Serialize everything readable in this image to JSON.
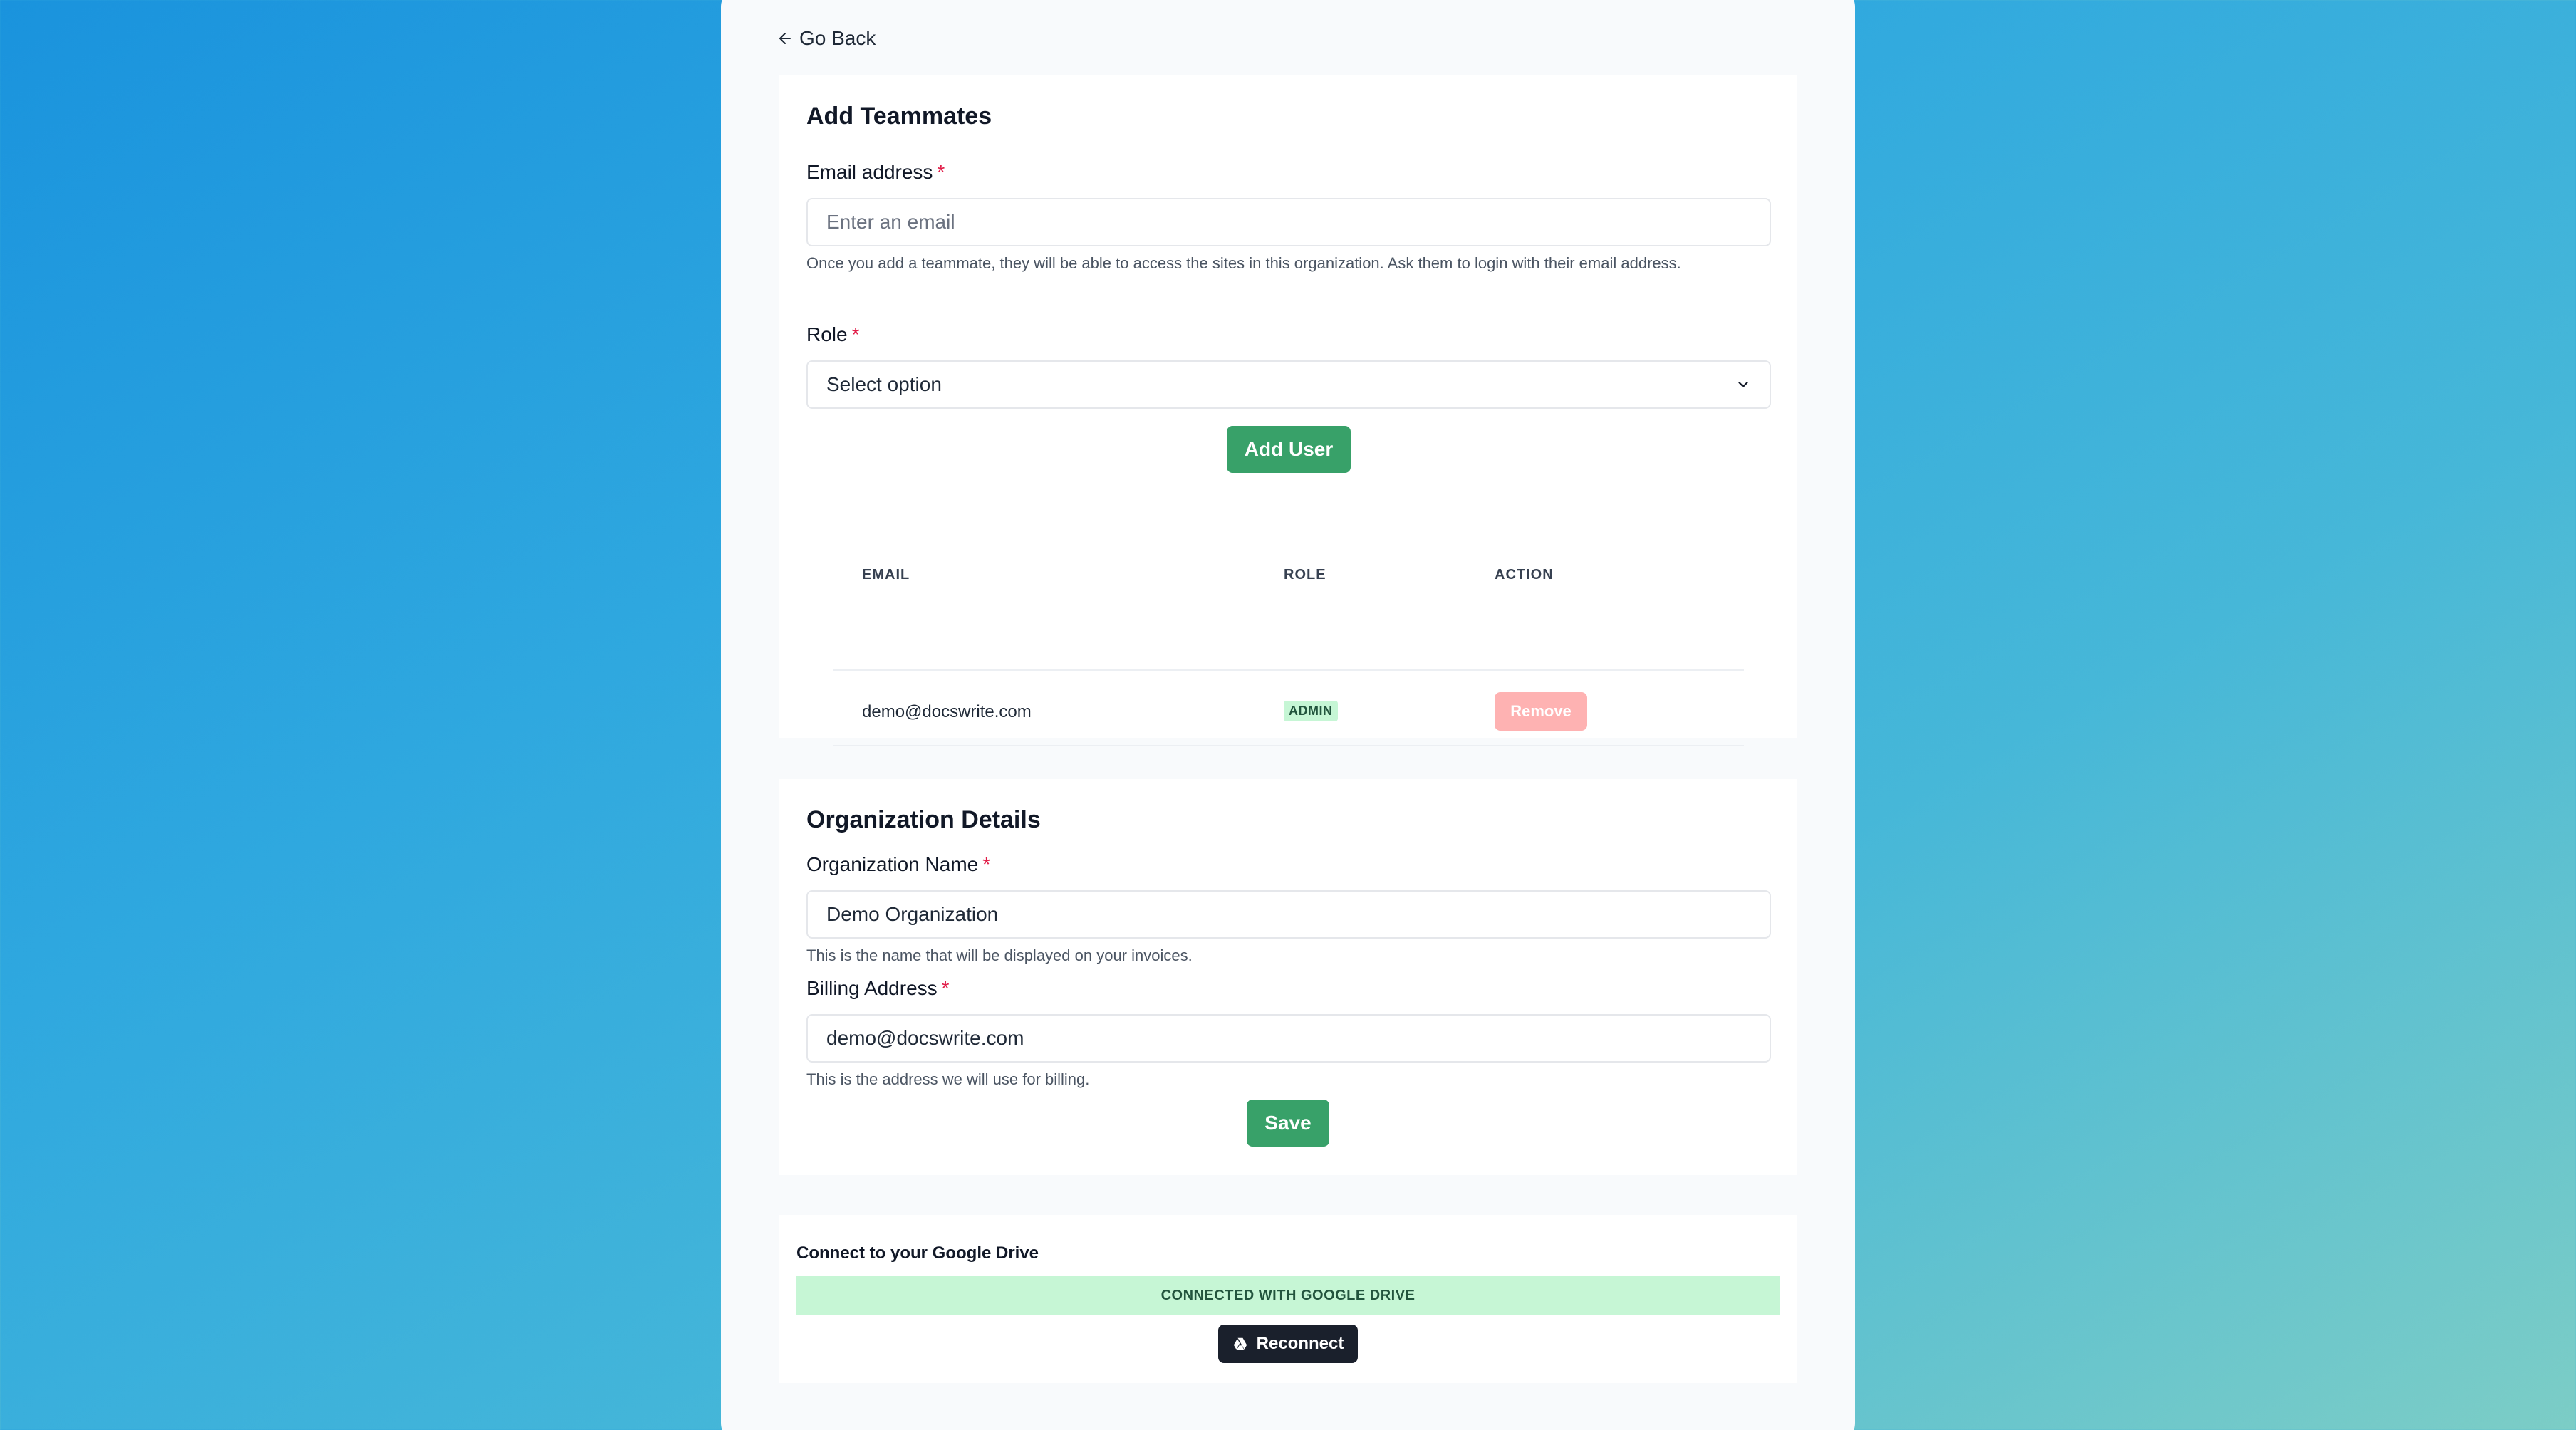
{
  "nav": {
    "go_back": "Go Back"
  },
  "teammates": {
    "title": "Add Teammates",
    "email_label": "Email address",
    "required_mark": "*",
    "email_placeholder": "Enter an email",
    "email_help": "Once you add a teammate, they will be able to access the sites in this organization. Ask them to login with their email address.",
    "role_label": "Role",
    "role_selected": "Select option",
    "add_user_label": "Add User",
    "table": {
      "headers": {
        "email": "EMAIL",
        "role": "ROLE",
        "action": "ACTION"
      },
      "rows": [
        {
          "email": "demo@docswrite.com",
          "role": "ADMIN",
          "action": "Remove"
        }
      ]
    }
  },
  "organization": {
    "title": "Organization Details",
    "name_label": "Organization Name",
    "name_value": "Demo Organization",
    "name_help": "This is the name that will be displayed on your invoices.",
    "billing_label": "Billing Address",
    "billing_value": "demo@docswrite.com",
    "billing_help": "This is the address we will use for billing.",
    "save_label": "Save"
  },
  "drive": {
    "title": "Connect to your Google Drive",
    "status": "CONNECTED WITH GOOGLE DRIVE",
    "reconnect_label": "Reconnect",
    "icon": "google-drive-icon"
  },
  "colors": {
    "accent_green": "#38a169",
    "badge_green_bg": "#c6f6d5",
    "remove_red": "#feb2b2",
    "required_red": "#e11d48",
    "dark_button": "#1a202c"
  }
}
